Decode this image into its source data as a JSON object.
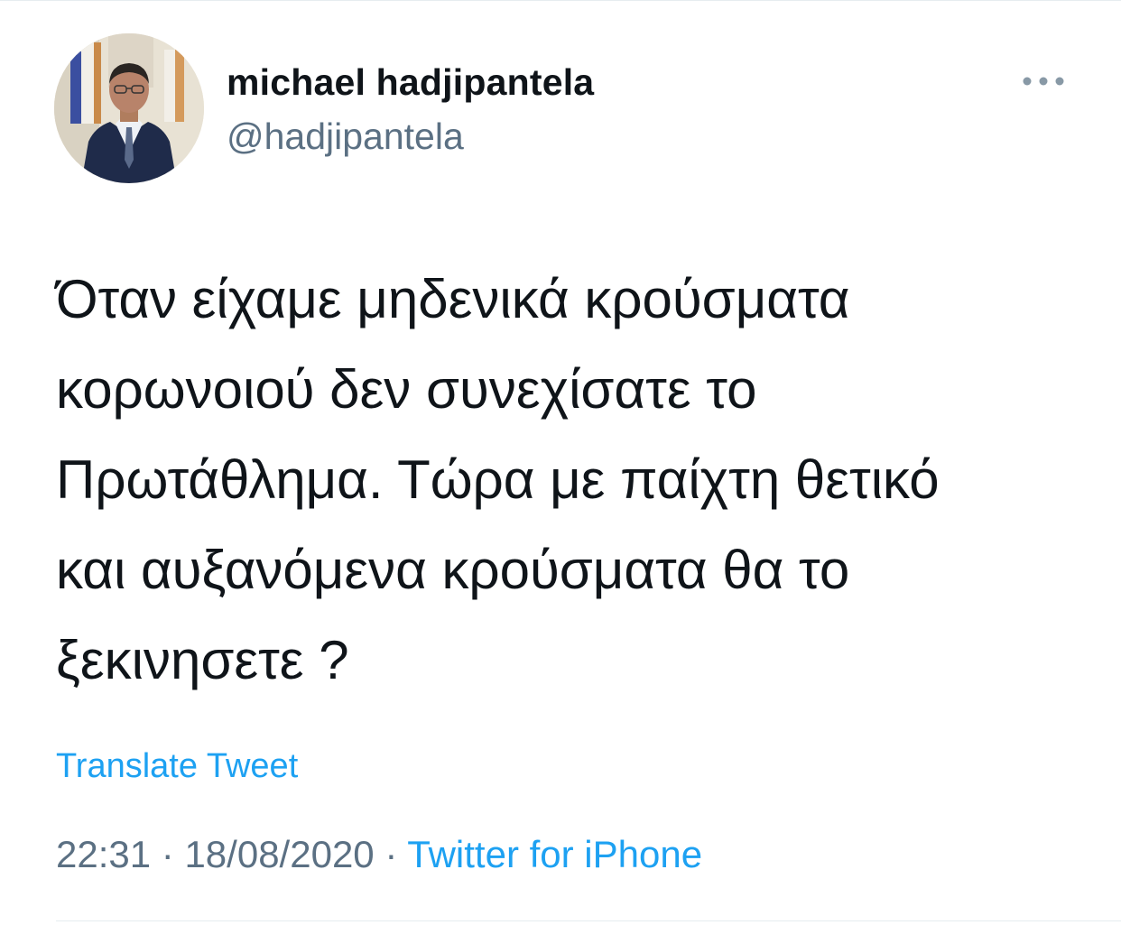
{
  "author": {
    "display_name": "michael hadjipantela",
    "handle": "@hadjipantela",
    "avatar_alt": "profile photo"
  },
  "more_icon": "ellipsis-icon",
  "tweet": {
    "lines": [
      "Όταν είχαμε μηδενικά κρούσματα",
      "κορωνοιού δεν συνεχίσατε το",
      "Πρωτάθλημα. Τώρα με παίχτη θετικό",
      "και αυξανόμενα κρούσματα θα το",
      "ξεκινησετε ?"
    ],
    "translate_label": "Translate Tweet",
    "time": "22:31",
    "separator": "·",
    "date": "18/08/2020",
    "source": "Twitter for iPhone"
  },
  "colors": {
    "accent": "#1da1f2",
    "secondary_text": "#5b7083",
    "primary_text": "#0f1419"
  }
}
